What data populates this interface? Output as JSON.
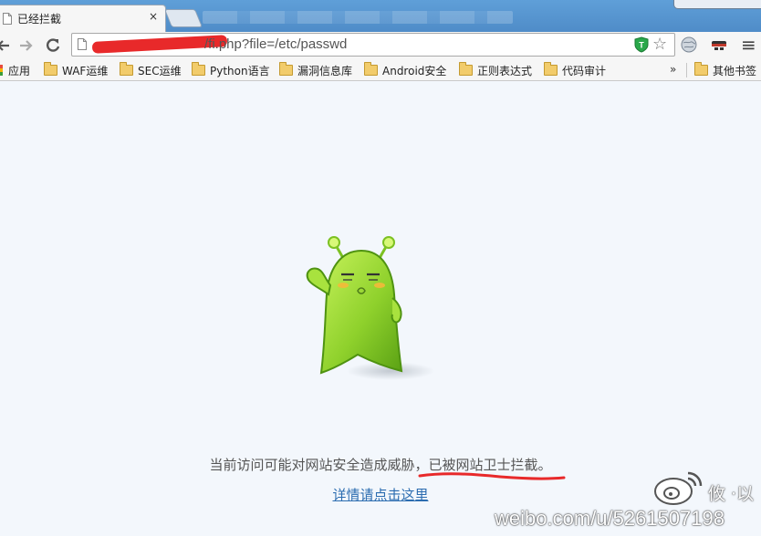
{
  "tab": {
    "title": "已经拦截",
    "close_glyph": "×"
  },
  "toolbar": {
    "back_icon": "back-arrow-icon",
    "forward_icon": "forward-arrow-icon",
    "reload_icon": "reload-icon",
    "url_visible": "/fi.php?file=/etc/passwd",
    "star_glyph": "☆",
    "menu_glyph": "≡"
  },
  "bookmarks": {
    "items": [
      {
        "label": "应用",
        "icon": "apps-icon"
      },
      {
        "label": "WAF运维",
        "icon": "folder-icon"
      },
      {
        "label": "SEC运维",
        "icon": "folder-icon"
      },
      {
        "label": "Python语言",
        "icon": "folder-icon"
      },
      {
        "label": "漏洞信息库",
        "icon": "folder-icon"
      },
      {
        "label": "Android安全",
        "icon": "folder-icon"
      },
      {
        "label": "正则表达式",
        "icon": "folder-icon"
      },
      {
        "label": "代码审计",
        "icon": "folder-icon"
      }
    ],
    "overflow_glyph": "»",
    "other": {
      "label": "其他书签",
      "icon": "folder-icon"
    }
  },
  "page": {
    "message": "当前访问可能对网站安全造成威胁，已被网站卫士拦截。",
    "link_text": "详情请点击这里"
  },
  "watermark": {
    "name": "攸 ·以",
    "url": "weibo.com/u/5261507198"
  },
  "colors": {
    "accent_red": "#e8292a",
    "mascot_green": "#8fd12c",
    "link_blue": "#2b6cb0"
  }
}
